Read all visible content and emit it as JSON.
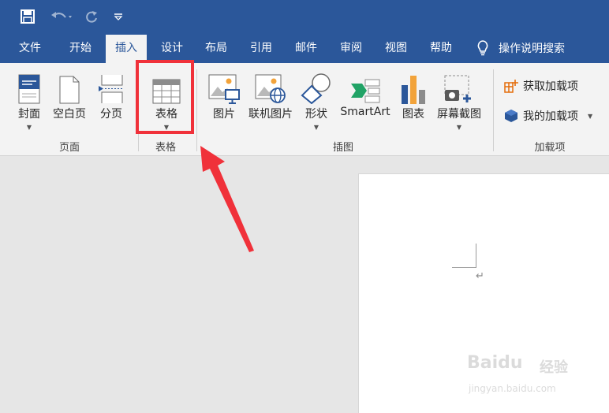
{
  "colors": {
    "title_bar": "#2b579a",
    "ribbon": "#f3f3f3",
    "highlight": "#f0313a",
    "accent_orange": "#e46c0a"
  },
  "quick_access": {
    "save": "save-icon",
    "undo": "undo-icon",
    "redo": "redo-icon",
    "customize": "customize-icon"
  },
  "tabs": [
    "文件",
    "开始",
    "插入",
    "设计",
    "布局",
    "引用",
    "邮件",
    "审阅",
    "视图",
    "帮助"
  ],
  "active_tab": "插入",
  "tell_me": "操作说明搜索",
  "ribbon": {
    "pages_group": {
      "label": "页面",
      "buttons": [
        "封面",
        "空白页",
        "分页"
      ]
    },
    "table_group": {
      "label": "表格",
      "button": "表格"
    },
    "illustrations_group": {
      "label": "插图",
      "buttons": [
        "图片",
        "联机图片",
        "形状",
        "SmartArt",
        "图表",
        "屏幕截图"
      ]
    },
    "addins_group": {
      "label": "加载项",
      "get": "获取加载项",
      "mine": "我的加载项"
    }
  },
  "document": {
    "paragraph_mark": "↵"
  },
  "watermark": {
    "brand": "Baidu",
    "suffix": "经验",
    "url": "jingyan.baidu.com"
  }
}
